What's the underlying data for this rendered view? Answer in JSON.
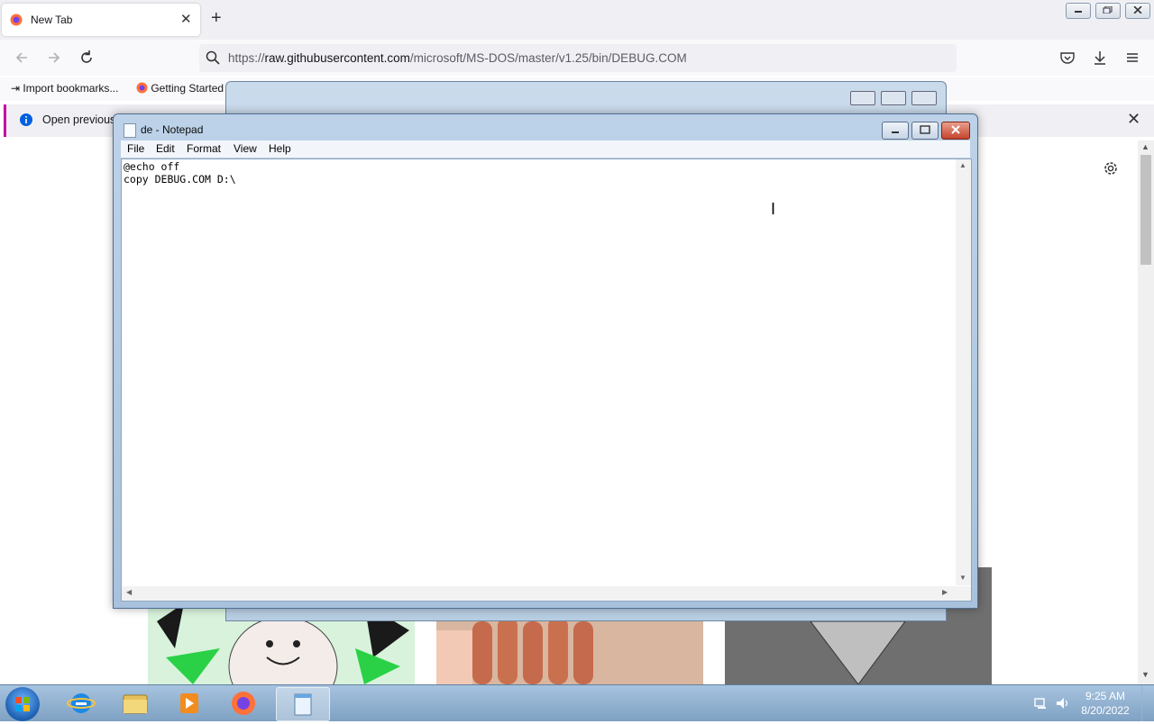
{
  "browser": {
    "tab_title": "New Tab",
    "new_tab_symbol": "+",
    "url_prefix": "https://",
    "url_host": "raw.githubusercontent.com",
    "url_path": "/microsoft/MS-DOS/master/v1.25/bin/DEBUG.COM",
    "bookmarks": [
      "Import bookmarks...",
      "Getting Started"
    ],
    "infobar_message": "Open previous"
  },
  "notepad": {
    "title": "de - Notepad",
    "menu": [
      "File",
      "Edit",
      "Format",
      "View",
      "Help"
    ],
    "content": "@echo off\ncopy DEBUG.COM D:\\"
  },
  "taskbar": {
    "time": "9:25 AM",
    "date": "8/20/2022"
  },
  "colors": {
    "infobar_accent": "#c800a4",
    "firefox_orange": "#ff7139"
  }
}
